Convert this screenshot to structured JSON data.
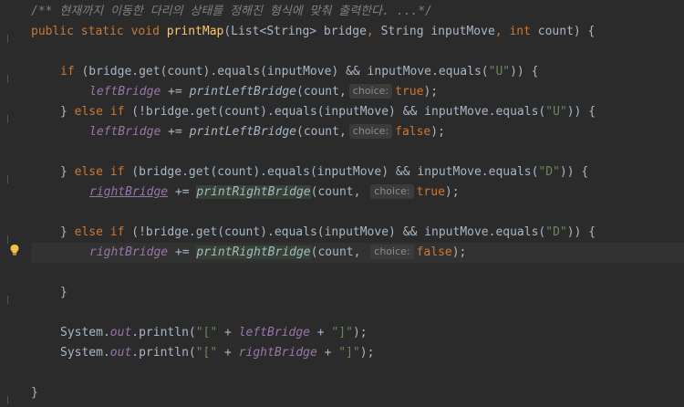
{
  "comment": "/** 현재까지 이동한 다리의 상태를 정해진 형식에 맞춰 출력한다. ...*/",
  "signature": {
    "kw_public": "public",
    "kw_static": "static",
    "kw_void": "void",
    "name": "printMap",
    "open": "(List<String> bridge",
    "comma1": ", ",
    "type2": "String inputMove",
    "comma2": ", ",
    "kw_int": "int",
    "rest": " count) {"
  },
  "branches": [
    {
      "lead_kw": "if",
      "cond_pre": " (bridge.get(count).equals(inputMove) ",
      "op": "&&",
      "cond_mid": " inputMove.equals(",
      "dir": "\"U\"",
      "cond_end": ")) {",
      "target": "leftBridge",
      "assign": " += ",
      "call": "printLeftBridge",
      "args": "(count,",
      "hint": "choice:",
      "bool": "true",
      "tail": ");"
    },
    {
      "lead_close": "} ",
      "lead_kw": "else if",
      "cond_pre": " (!bridge.get(count).equals(inputMove) ",
      "op": "&&",
      "cond_mid": " inputMove.equals(",
      "dir": "\"U\"",
      "cond_end": ")) {",
      "target": "leftBridge",
      "assign": " += ",
      "call": "printLeftBridge",
      "args": "(count,",
      "hint": "choice:",
      "bool": "false",
      "tail": ");"
    },
    {
      "lead_close": "} ",
      "lead_kw": "else if",
      "cond_pre": " (bridge.get(count).equals(inputMove) ",
      "op": "&&",
      "cond_mid": " inputMove.equals(",
      "dir": "\"D\"",
      "cond_end": ")) {",
      "target": "rightBridge",
      "assign": " += ",
      "call": "printRightBridge",
      "args": "(count, ",
      "hint": "choice:",
      "bool": "true",
      "tail": ");"
    },
    {
      "lead_close": "} ",
      "lead_kw": "else if",
      "cond_pre": " (!bridge.get(count).equals(inputMove) ",
      "op": "&&",
      "cond_mid": " inputMove.equals(",
      "dir": "\"D\"",
      "cond_end": ")) {",
      "target": "rightBridge",
      "assign": " += ",
      "call": "printRightBridge",
      "args": "(count, ",
      "hint": "choice:",
      "bool": "false",
      "tail": ");"
    }
  ],
  "close_if": "}",
  "prints": [
    {
      "sys": "System.",
      "out": "out",
      "println": ".println(",
      "s1": "\"[\"",
      "plus1": " + ",
      "var": "leftBridge",
      "plus2": " + ",
      "s2": "\"]\"",
      "end": ");"
    },
    {
      "sys": "System.",
      "out": "out",
      "println": ".println(",
      "s1": "\"[\"",
      "plus1": " + ",
      "var": "rightBridge",
      "plus2": " + ",
      "s2": "\"]\"",
      "end": ");"
    }
  ],
  "close_method": "}",
  "icons": {
    "lightbulb": "lightbulb-icon",
    "fold": "fold-marker-icon"
  }
}
